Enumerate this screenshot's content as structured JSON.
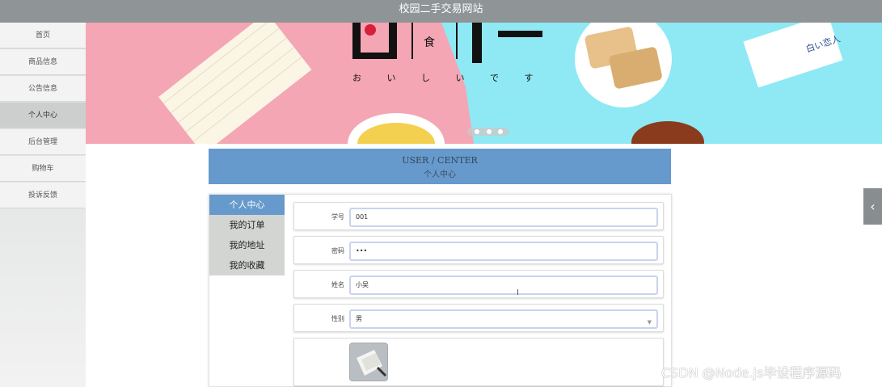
{
  "window": {
    "title": "校园二手交易网站"
  },
  "sidebar": {
    "items": [
      {
        "label": "首页",
        "active": false
      },
      {
        "label": "商品信息",
        "active": false
      },
      {
        "label": "公告信息",
        "active": false
      },
      {
        "label": "个人中心",
        "active": true
      },
      {
        "label": "后台管理",
        "active": false
      },
      {
        "label": "购物车",
        "active": false
      },
      {
        "label": "投诉反馈",
        "active": false
      }
    ]
  },
  "banner": {
    "large_glyph_left": "日",
    "small_glyph": "食",
    "large_glyph_right": "本",
    "kana": "お い し い で す",
    "package_text": "白い恋人",
    "dots": 3,
    "active_dot": 1
  },
  "center": {
    "title_en": "USER / CENTER",
    "title_zh": "个人中心"
  },
  "menu": {
    "items": [
      {
        "label": "个人中心",
        "active": true
      },
      {
        "label": "我的订单",
        "active": false
      },
      {
        "label": "我的地址",
        "active": false
      },
      {
        "label": "我的收藏",
        "active": false
      }
    ]
  },
  "form": {
    "student_id": {
      "label": "学号",
      "value": "001"
    },
    "password": {
      "label": "密码",
      "value": "•••"
    },
    "name": {
      "label": "姓名",
      "value": "小吴"
    },
    "gender": {
      "label": "性别",
      "value": "男"
    },
    "avatar_icon": "photo-thumbnail-icon"
  },
  "right_tab": {
    "icon": "chevron-left-icon",
    "glyph": "‹"
  },
  "watermark": "CSDN @Node.js毕设程序源码",
  "colors": {
    "accent": "#6699cc",
    "topbar": "#8f9596",
    "banner_pink": "#f4a6b4",
    "banner_cyan": "#8ee9f4"
  }
}
